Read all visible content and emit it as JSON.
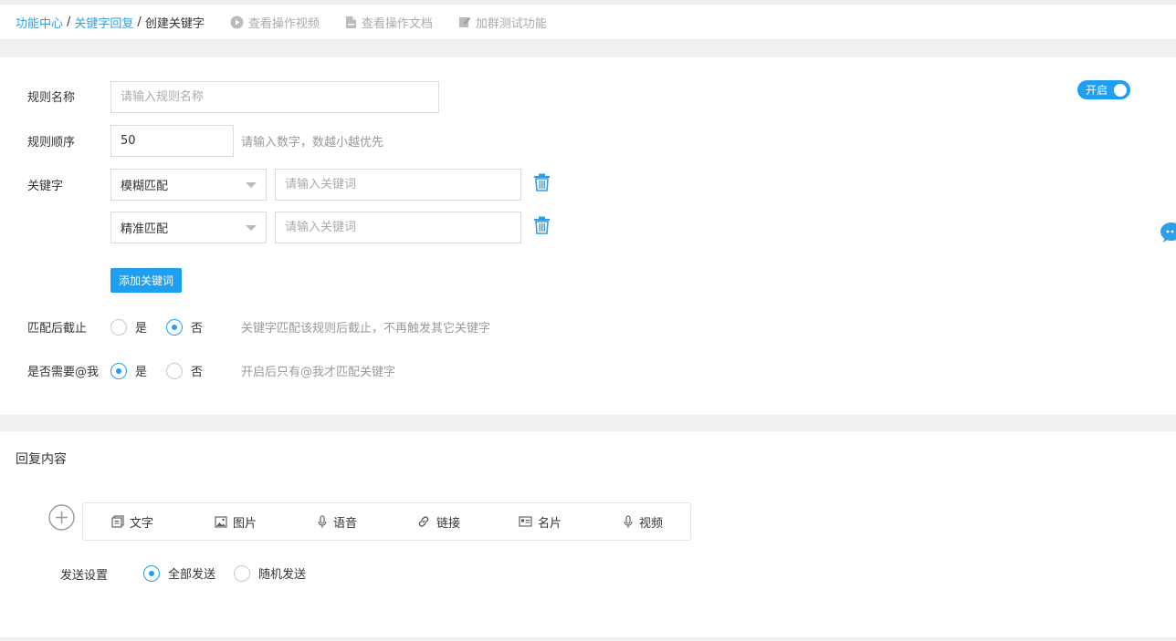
{
  "breadcrumb": {
    "item1": "功能中心",
    "sep": "/",
    "item2": "关键字回复",
    "current": "创建关键字"
  },
  "top_links": {
    "video": "查看操作视频",
    "doc": "查看操作文档",
    "group": "加群测试功能"
  },
  "form": {
    "toggle_label": "开启",
    "rule_name_label": "规则名称",
    "rule_name_placeholder": "请输入规则名称",
    "rule_name_value": "",
    "rule_order_label": "规则顺序",
    "rule_order_value": "50",
    "rule_order_hint": "请输入数字，数越小越优先",
    "keyword_label": "关键字",
    "keywords": [
      {
        "match": "模糊匹配",
        "placeholder": "请输入关键词",
        "value": ""
      },
      {
        "match": "精准匹配",
        "placeholder": "请输入关键词",
        "value": ""
      }
    ],
    "add_keyword_button": "添加关键词",
    "stop_after_match_label": "匹配后截止",
    "stop_after_match_options": [
      "是",
      "否"
    ],
    "stop_after_match_selected": "否",
    "stop_after_match_hint": "关键字匹配该规则后截止，不再触发其它关键字",
    "need_at_label": "是否需要@我",
    "need_at_options": [
      "是",
      "否"
    ],
    "need_at_selected": "是",
    "need_at_hint": "开启后只有@我才匹配关键字"
  },
  "reply": {
    "title": "回复内容",
    "tools": [
      {
        "label": "文字",
        "icon": "text-icon"
      },
      {
        "label": "图片",
        "icon": "image-icon"
      },
      {
        "label": "语音",
        "icon": "microphone-icon"
      },
      {
        "label": "链接",
        "icon": "link-icon"
      },
      {
        "label": "名片",
        "icon": "card-icon"
      },
      {
        "label": "视频",
        "icon": "microphone-icon"
      }
    ],
    "send_setting_label": "发送设置",
    "send_options": [
      "全部发送",
      "随机发送"
    ],
    "send_selected": "全部发送"
  },
  "colors": {
    "accent": "#1e9ff2",
    "link": "#2d9fe8",
    "background": "#f0f0f0"
  }
}
